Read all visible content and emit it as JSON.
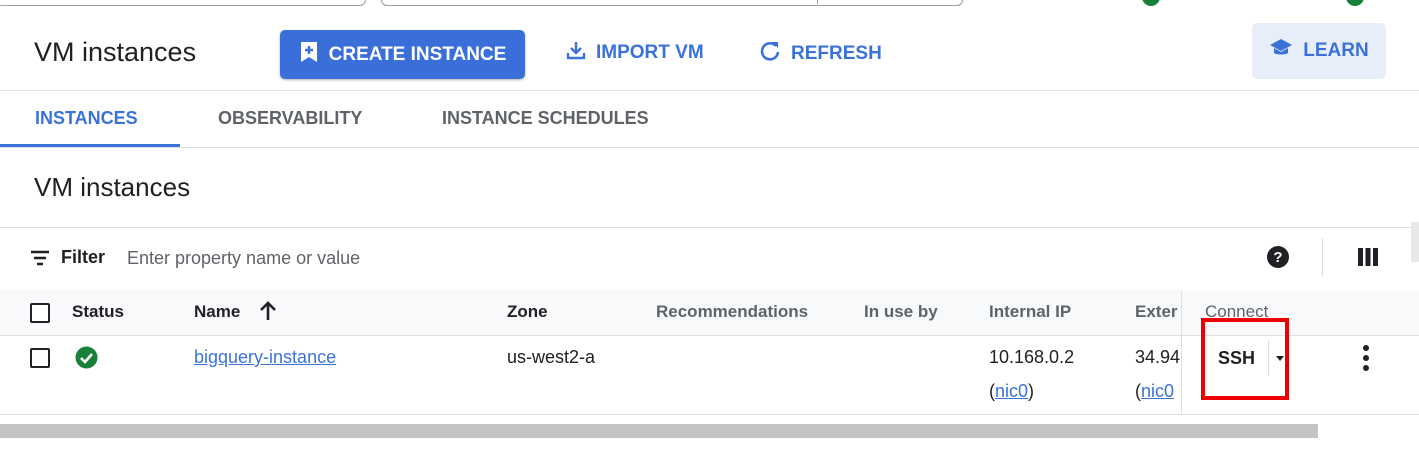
{
  "header": {
    "title": "VM instances",
    "create_label": "CREATE INSTANCE",
    "import_label": "IMPORT VM",
    "refresh_label": "REFRESH",
    "learn_label": "LEARN"
  },
  "tabs": [
    {
      "label": "INSTANCES",
      "active": true
    },
    {
      "label": "OBSERVABILITY",
      "active": false
    },
    {
      "label": "INSTANCE SCHEDULES",
      "active": false
    }
  ],
  "section": {
    "title": "VM instances"
  },
  "filter": {
    "label": "Filter",
    "placeholder": "Enter property name or value"
  },
  "table": {
    "columns": [
      "Status",
      "Name",
      "Zone",
      "Recommendations",
      "In use by",
      "Internal IP",
      "Exter",
      "Connect"
    ],
    "rows": [
      {
        "status": "running",
        "name": "bigquery-instance",
        "zone": "us-west2-a",
        "recommendations": "",
        "in_use_by": "",
        "internal_ip": "10.168.0.2",
        "internal_nic": "nic0",
        "external_ip": "34.94",
        "external_nic": "nic0",
        "connect": "SSH"
      }
    ]
  },
  "icons": {
    "create": "add-box-icon",
    "import": "download-icon",
    "refresh": "refresh-icon",
    "learn": "school-icon",
    "filter": "filter-icon",
    "help": "help-icon",
    "columns": "column-display-icon",
    "sort": "arrow-up-icon",
    "status": "check-circle-icon",
    "more": "more-vert-icon"
  },
  "colors": {
    "accent": "#3b72d8",
    "button_bg": "#3a6fd9",
    "learn_bg": "#e8eef9",
    "status_ok": "#188038",
    "highlight": "#ee0000"
  }
}
